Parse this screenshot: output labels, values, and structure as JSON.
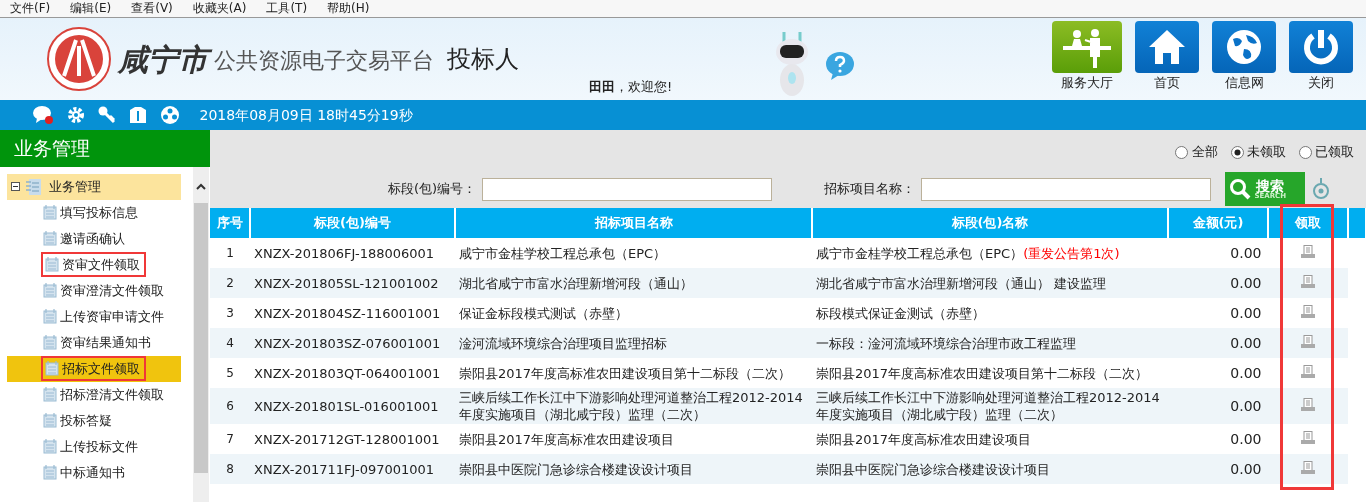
{
  "menu": [
    "文件(F)",
    "编辑(E)",
    "查看(V)",
    "收藏夹(A)",
    "工具(T)",
    "帮助(H)"
  ],
  "header": {
    "city": "咸宁市",
    "platform": "公共资源电子交易平台",
    "role": "投标人",
    "user": "田田",
    "welcome": "，欢迎您!",
    "nav": [
      {
        "label": "服务大厅",
        "kind": "hall"
      },
      {
        "label": "首页",
        "kind": "home"
      },
      {
        "label": "信息网",
        "kind": "globe"
      },
      {
        "label": "关闭",
        "kind": "power"
      }
    ]
  },
  "toolbar": {
    "datetime": "2018年08月09日 18时45分19秒"
  },
  "sidebar": {
    "title": "业务管理",
    "root": {
      "label": "业务管理",
      "expanded": true,
      "children": [
        {
          "label": "填写投标信息",
          "selected": false,
          "boxed": false
        },
        {
          "label": "邀请函确认",
          "selected": false,
          "boxed": false
        },
        {
          "label": "资审文件领取",
          "selected": false,
          "boxed": true
        },
        {
          "label": "资审澄清文件领取",
          "selected": false,
          "boxed": false
        },
        {
          "label": "上传资审申请文件",
          "selected": false,
          "boxed": false
        },
        {
          "label": "资审结果通知书",
          "selected": false,
          "boxed": false
        },
        {
          "label": "招标文件领取",
          "selected": true,
          "boxed": true
        },
        {
          "label": "招标澄清文件领取",
          "selected": false,
          "boxed": false
        },
        {
          "label": "投标答疑",
          "selected": false,
          "boxed": false
        },
        {
          "label": "上传投标文件",
          "selected": false,
          "boxed": false
        },
        {
          "label": "中标通知书",
          "selected": false,
          "boxed": false
        }
      ]
    }
  },
  "filter": [
    {
      "label": "全部",
      "selected": false
    },
    {
      "label": "未领取",
      "selected": true
    },
    {
      "label": "已领取",
      "selected": false
    }
  ],
  "search": {
    "code_label": "标段(包)编号：",
    "name_label": "招标项目名称：",
    "button": "搜索",
    "button_sub": "SEARCH"
  },
  "table": {
    "columns": [
      "序号",
      "标段(包)编号",
      "招标项目名称",
      "标段(包)名称",
      "金额(元)",
      "领取"
    ],
    "rows": [
      {
        "no": "1",
        "code": "XNZX-201806FJ-188006001",
        "project": "咸宁市金桂学校工程总承包（EPC）",
        "section": "咸宁市金桂学校工程总承包（EPC）",
        "note": "(重发公告第1次)",
        "amount": "0.00"
      },
      {
        "no": "2",
        "code": "XNZX-201805SL-121001002",
        "project": "湖北省咸宁市富水治理新增河段（通山）",
        "section": "湖北省咸宁市富水治理新增河段（通山） 建设监理",
        "amount": "0.00"
      },
      {
        "no": "3",
        "code": "XNZX-201804SZ-116001001",
        "project": "保证金标段模式测试（赤壁）",
        "section": "标段模式保证金测试（赤壁）",
        "amount": "0.00"
      },
      {
        "no": "4",
        "code": "XNZX-201803SZ-076001001",
        "project": "淦河流域环境综合治理项目监理招标",
        "section": "一标段：淦河流域环境综合治理市政工程监理",
        "amount": "0.00"
      },
      {
        "no": "5",
        "code": "XNZX-201803QT-064001001",
        "project": "崇阳县2017年度高标准农田建设项目第十二标段（二次）",
        "section": "崇阳县2017年度高标准农田建设项目第十二标段（二次）",
        "amount": "0.00"
      },
      {
        "no": "6",
        "code": "XNZX-201801SL-016001001",
        "project": "三峡后续工作长江中下游影响处理河道整治工程2012-2014年度实施项目（湖北咸宁段）监理（二次）",
        "section": "三峡后续工作长江中下游影响处理河道整治工程2012-2014年度实施项目（湖北咸宁段）监理（二次）",
        "amount": "0.00"
      },
      {
        "no": "7",
        "code": "XNZX-201712GT-128001001",
        "project": "崇阳县2017年度高标准农田建设项目",
        "section": "崇阳县2017年度高标准农田建设项目",
        "amount": "0.00"
      },
      {
        "no": "8",
        "code": "XNZX-201711FJ-097001001",
        "project": "崇阳县中医院门急诊综合楼建设设计项目",
        "section": "崇阳县中医院门急诊综合楼建设设计项目",
        "amount": "0.00"
      }
    ]
  }
}
